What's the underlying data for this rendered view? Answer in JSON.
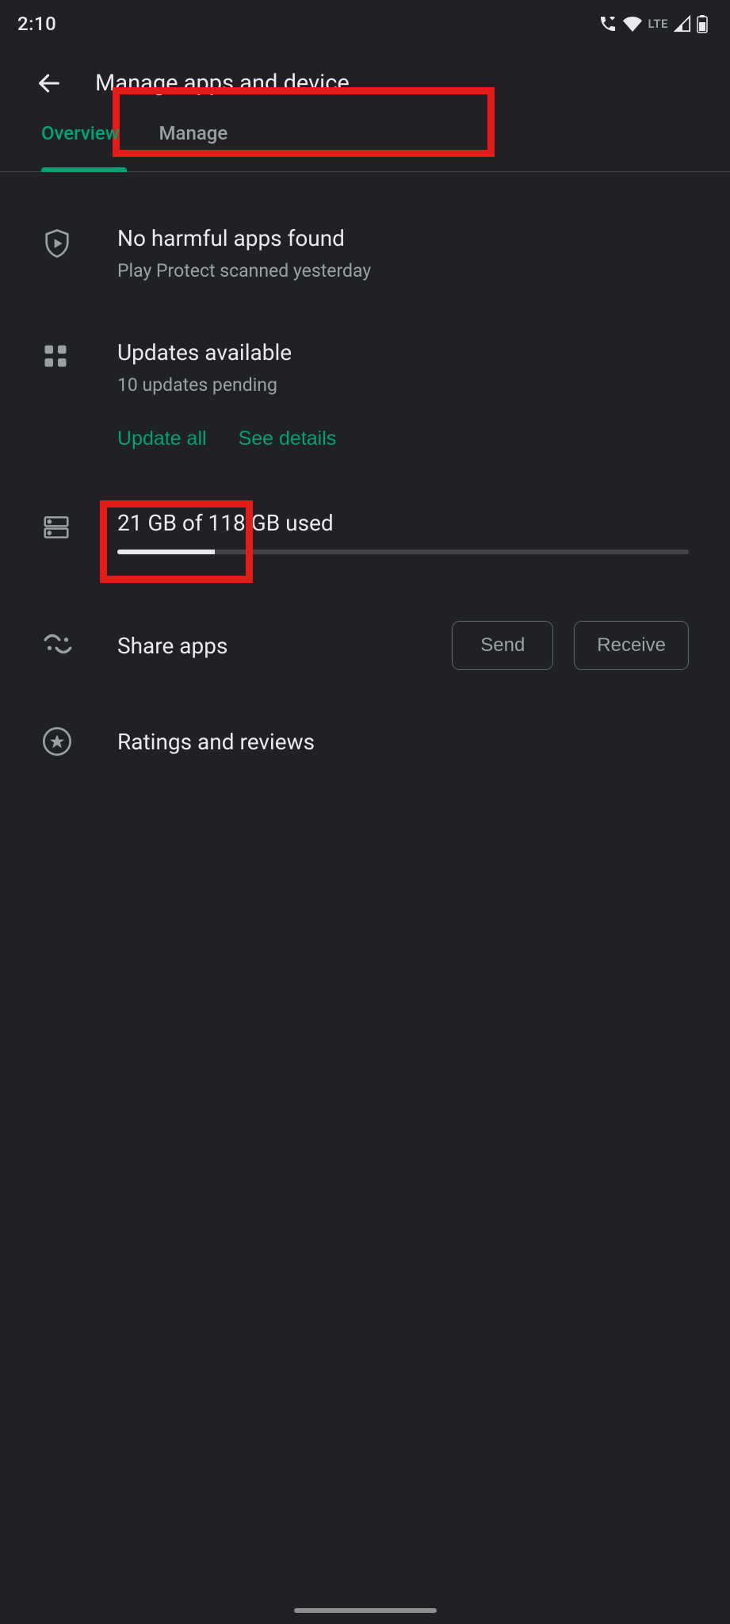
{
  "status": {
    "time": "2:10",
    "network_label": "LTE"
  },
  "header": {
    "title": "Manage apps and device"
  },
  "tabs": {
    "overview": "Overview",
    "manage": "Manage"
  },
  "protect": {
    "title": "No harmful apps found",
    "subtitle": "Play Protect scanned yesterday"
  },
  "updates": {
    "title": "Updates available",
    "subtitle": "10 updates pending",
    "update_all": "Update all",
    "see_details": "See details"
  },
  "storage": {
    "text": "21 GB of 118 GB used",
    "percent_used": 17
  },
  "share": {
    "label": "Share apps",
    "send": "Send",
    "receive": "Receive"
  },
  "ratings": {
    "label": "Ratings and reviews"
  },
  "colors": {
    "accent": "#00a173",
    "highlight": "#e41b17"
  }
}
